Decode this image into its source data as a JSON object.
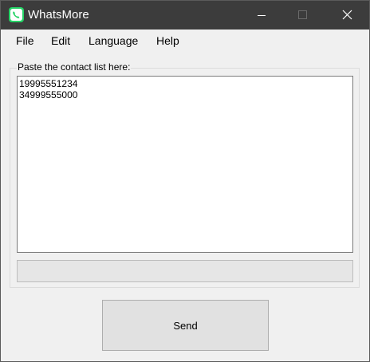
{
  "window": {
    "title": "WhatsMore",
    "icon": "whatsapp-phone-icon",
    "controls": [
      "minimize-icon",
      "maximize-icon",
      "close-icon"
    ],
    "accent_color": "#25d366",
    "titlebar_color": "#3c3c3c"
  },
  "menu": {
    "file": "File",
    "edit": "Edit",
    "language": "Language",
    "help": "Help"
  },
  "contacts": {
    "label": "Paste the contact list here:",
    "lines": [
      "19995551234",
      "34999555000"
    ]
  },
  "progress": {
    "value": 0
  },
  "actions": {
    "send_label": "Send"
  }
}
